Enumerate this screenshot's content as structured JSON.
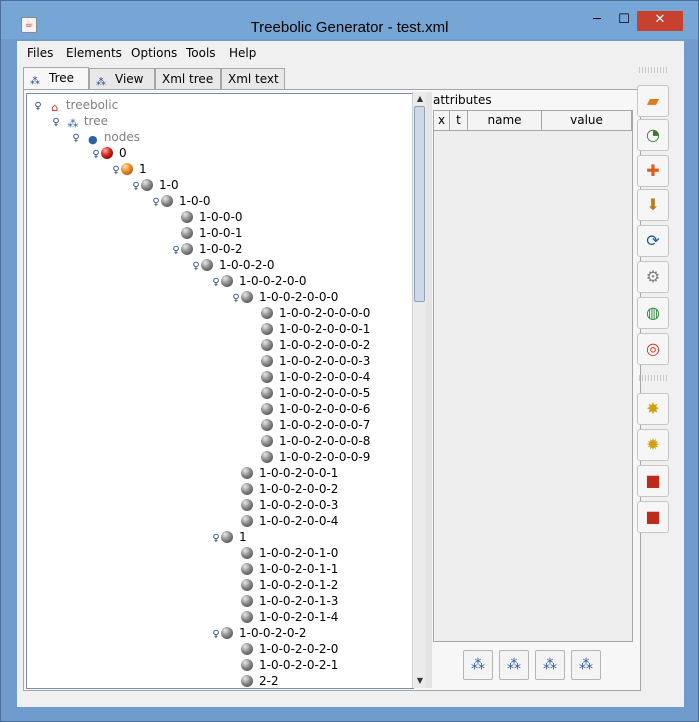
{
  "window": {
    "title": "Treebolic Generator - test.xml",
    "min_glyph": "─",
    "max_glyph": "☐",
    "close_glyph": "✕"
  },
  "menu": [
    "Files",
    "Elements",
    "Options",
    "Tools",
    "Help"
  ],
  "tabs": [
    {
      "label": "Tree",
      "icon": "tree-icon",
      "active": true
    },
    {
      "label": "View",
      "icon": "view-icon",
      "active": false
    },
    {
      "label": "Xml tree",
      "active": false
    },
    {
      "label": "Xml text",
      "active": false
    }
  ],
  "tree": {
    "root": "treebolic",
    "tree_label": "tree",
    "nodes_label": "nodes",
    "items": [
      "0",
      "1",
      "1-0",
      "1-0-0",
      "1-0-0-0",
      "1-0-0-1",
      "1-0-0-2",
      "1-0-0-2-0",
      "1-0-0-2-0-0",
      "1-0-0-2-0-0-0",
      "1-0-0-2-0-0-0-0",
      "1-0-0-2-0-0-0-1",
      "1-0-0-2-0-0-0-2",
      "1-0-0-2-0-0-0-3",
      "1-0-0-2-0-0-0-4",
      "1-0-0-2-0-0-0-5",
      "1-0-0-2-0-0-0-6",
      "1-0-0-2-0-0-0-7",
      "1-0-0-2-0-0-0-8",
      "1-0-0-2-0-0-0-9",
      "1-0-0-2-0-0-1",
      "1-0-0-2-0-0-2",
      "1-0-0-2-0-0-3",
      "1-0-0-2-0-0-4",
      "1",
      "1-0-0-2-0-1-0",
      "1-0-0-2-0-1-1",
      "1-0-0-2-0-1-2",
      "1-0-0-2-0-1-3",
      "1-0-0-2-0-1-4",
      "1-0-0-2-0-2",
      "1-0-0-2-0-2-0",
      "1-0-0-2-0-2-1",
      "2-2"
    ]
  },
  "attributes": {
    "label": "attributes",
    "columns": [
      "x",
      "t",
      "name",
      "value"
    ]
  },
  "icons": {
    "toolbar": [
      "open-folder-icon",
      "open-url-icon",
      "new-document-icon",
      "save-icon",
      "refresh-icon",
      "settings-doc-icon",
      "globe-doc-icon",
      "help-lifebuoy-icon",
      "add-node-icon",
      "remove-node-icon",
      "move-node-icon",
      "copy-node-icon"
    ],
    "attr_buttons": [
      "tree-layout-1-icon",
      "tree-layout-2-icon",
      "tree-layout-3-icon",
      "tree-layout-4-icon"
    ]
  }
}
